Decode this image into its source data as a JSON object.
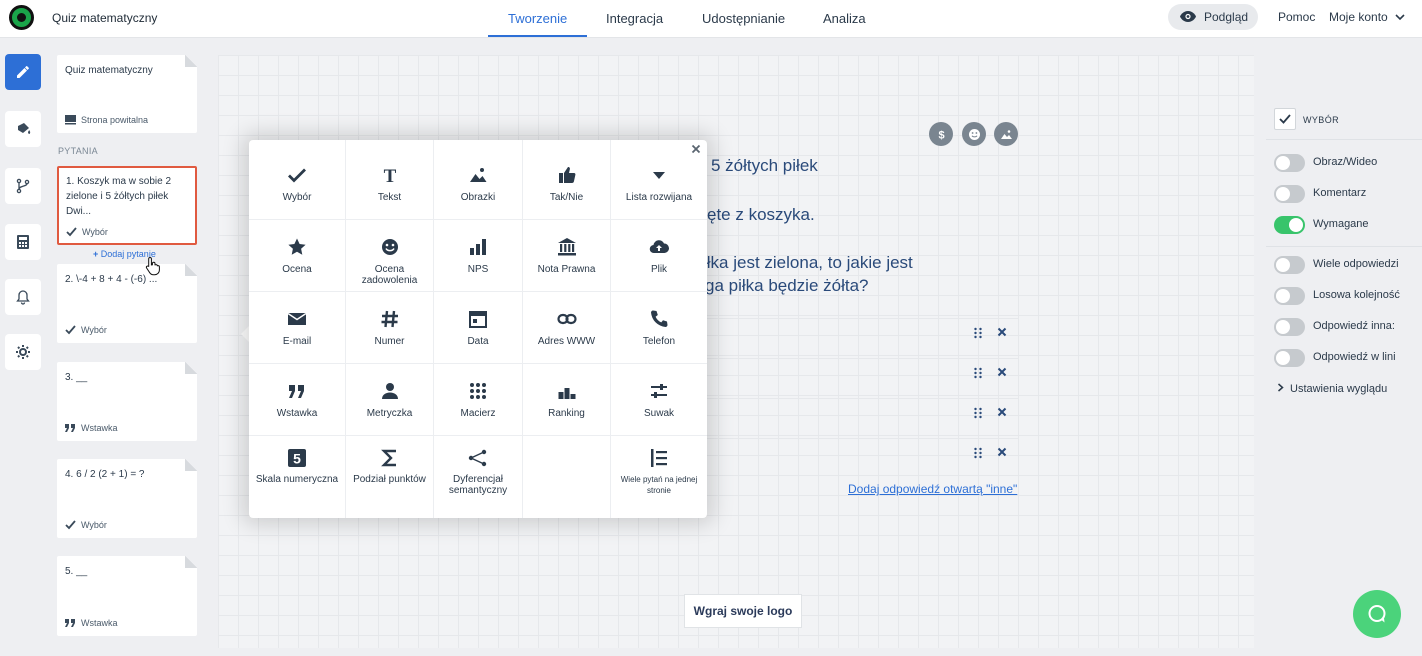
{
  "app": {
    "title": "Quiz matematyczny"
  },
  "nav": {
    "tabs": [
      {
        "label": "Tworzenie"
      },
      {
        "label": "Integracja"
      },
      {
        "label": "Udostępnianie"
      },
      {
        "label": "Analiza"
      }
    ],
    "preview_label": "Podgląd",
    "help_label": "Pomoc",
    "account_label": "Moje konto"
  },
  "sidebar": {
    "welcome_card": {
      "title": "Quiz matematyczny",
      "type_label": "Strona powitalna"
    },
    "section_label": "PYTANIA",
    "add_question_label": "Dodaj pytanie",
    "questions": [
      {
        "text": "1. Koszyk ma w sobie 2 zielone i 5 żółtych piłek Dwi...",
        "type": "Wybór"
      },
      {
        "text": "2. \\-4 + 8 + 4 - (-6) ...",
        "type": "Wybór"
      },
      {
        "text": "3. __",
        "type": "Wstawka"
      },
      {
        "text": "4. 6 / 2 (2 + 1) = ?",
        "type": "Wybór"
      },
      {
        "text": "5. __",
        "type": "Wstawka"
      }
    ]
  },
  "canvas": {
    "question_fragments": [
      "5 żółtych piłek",
      "ęte z koszyka.",
      "iłka jest zielona, to jakie jest",
      "ga piłka będzie żółta?"
    ],
    "add_other_label": "Dodaj odpowiedź otwartą \"inne\"",
    "upload_logo_label": "Wgraj swoje logo"
  },
  "popover": {
    "items": [
      {
        "label": "Wybór",
        "icon": "check-icon"
      },
      {
        "label": "Tekst",
        "icon": "text-icon"
      },
      {
        "label": "Obrazki",
        "icon": "image-icon"
      },
      {
        "label": "Tak/Nie",
        "icon": "thumbs-up-icon"
      },
      {
        "label": "Lista rozwijana",
        "icon": "caret-down-icon"
      },
      {
        "label": "Ocena",
        "icon": "star-icon"
      },
      {
        "label": "Ocena zadowolenia",
        "icon": "smiley-icon"
      },
      {
        "label": "NPS",
        "icon": "bar-chart-icon"
      },
      {
        "label": "Nota Prawna",
        "icon": "bank-icon"
      },
      {
        "label": "Plik",
        "icon": "cloud-upload-icon"
      },
      {
        "label": "E-mail",
        "icon": "envelope-icon"
      },
      {
        "label": "Numer",
        "icon": "hash-icon"
      },
      {
        "label": "Data",
        "icon": "calendar-icon"
      },
      {
        "label": "Adres WWW",
        "icon": "link-icon"
      },
      {
        "label": "Telefon",
        "icon": "phone-icon"
      },
      {
        "label": "Wstawka",
        "icon": "quote-icon"
      },
      {
        "label": "Metryczka",
        "icon": "person-icon"
      },
      {
        "label": "Macierz",
        "icon": "matrix-icon"
      },
      {
        "label": "Ranking",
        "icon": "podium-icon"
      },
      {
        "label": "Suwak",
        "icon": "sliders-icon"
      },
      {
        "label": "Skala numeryczna",
        "icon": "number-five-icon"
      },
      {
        "label": "Podział punktów",
        "icon": "sigma-icon"
      },
      {
        "label": "Dyferencjał semantyczny",
        "icon": "share-nodes-icon"
      },
      {
        "label": "",
        "icon": ""
      },
      {
        "label": "Wiele pytań na jednej stronie",
        "icon": "list-lines-icon"
      }
    ]
  },
  "settings": {
    "heading": "WYBÓR",
    "toggles": [
      {
        "label": "Obraz/Wideo",
        "on": false
      },
      {
        "label": "Komentarz",
        "on": false
      },
      {
        "label": "Wymagane",
        "on": true
      },
      {
        "label": "Wiele odpowiedzi",
        "on": false
      },
      {
        "label": "Losowa kolejność",
        "on": false
      },
      {
        "label": "Odpowiedź inna:",
        "on": false
      },
      {
        "label": "Odpowiedź w lini",
        "on": false
      }
    ],
    "appearance_label": "Ustawienia wyglądu"
  },
  "colors": {
    "accent": "#2d6fd6",
    "selected_border": "#e05a40",
    "toggle_on": "#38c46b",
    "chat": "#4bd37b"
  }
}
